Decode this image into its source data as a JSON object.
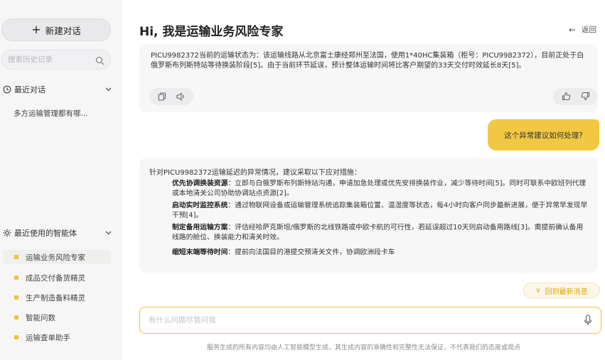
{
  "sidebar": {
    "new_chat_label": "新建对话",
    "search_placeholder": "搜索历史记录",
    "recent_section": "最近对话",
    "recent_items": [
      "多方运输管理都有哪..."
    ],
    "agents_section": "最近使用的智能体",
    "agents": [
      {
        "label": "运输业务风险专家",
        "active": true
      },
      {
        "label": "成品交付备货精灵",
        "active": false
      },
      {
        "label": "生产制造备料精灵",
        "active": false
      },
      {
        "label": "智能问数",
        "active": false
      },
      {
        "label": "运输查单助手",
        "active": false
      }
    ]
  },
  "main": {
    "title": "Hi, 我是运输业务风险专家",
    "back_label": "返回",
    "messages": {
      "ai_1": "PICU9982372当前的运输状态为：该运输线路从北京富士康经郑州至法国，使用1*40HC集装箱（柜号：PICU9982372），目前正处于白俄罗斯布列斯特站等待换装阶段[5]。由于当前环节延误，预计整体运输时间将比客户期望的33天交付时效延长8天[5]。",
      "user_1": "这个异常建议如何处理?",
      "ai_2_intro": "针对PICU9982372运输延迟的异常情况，建议采取以下应对措施：",
      "ai_2_items": [
        {
          "title": "优先协调换装资源",
          "body": "：立即与白俄罗斯布列斯特站沟通，申请加急处理或优先安排换装作业，减少等待时间[5]。同时可联系中欧班列代理或本地清关公司协助协调站点资源[2]。"
        },
        {
          "title": "启动实时监控系统",
          "body": "：通过物联网设备或运输管理系统追踪集装箱位置、温湿度等状态，每4小时向客户同步最新进展，便于异常早发现早干预[4]。"
        },
        {
          "title": "制定备用运输方案",
          "body": "：评估经哈萨克斯坦/俄罗斯的北线铁路或中欧卡航的可行性，若延误超过10天则启动备用路线[3]。需提前确认备用线路的舱位、换装能力和清关时效。"
        },
        {
          "title": "缩短末端等待时间",
          "body": "：提前向法国目的港提交预清关文件，协调欧洲段卡车"
        }
      ]
    },
    "jump_latest_label": "回到最新消息",
    "input_placeholder": "有什么问题尽管问我",
    "disclaimer": "服务生成的所有内容均由人工智能模型生成，其生成内容的准确性和完整性无法保证，不代表我们的态度或观点"
  },
  "icons": {
    "search": "search-icon",
    "clock": "clock-icon",
    "agents": "sparkle-icon",
    "copy": "copy-icon",
    "speaker": "speaker-icon",
    "like": "thumbs-up-icon",
    "dislike": "thumbs-down-icon",
    "mic": "microphone-icon",
    "back": "arrow-left-icon"
  },
  "colors": {
    "accent": "#f2c843",
    "jump_text": "#e0a500",
    "sidebar_bg": "#f6f6f7",
    "bubble_bg": "#f7f7f8"
  }
}
